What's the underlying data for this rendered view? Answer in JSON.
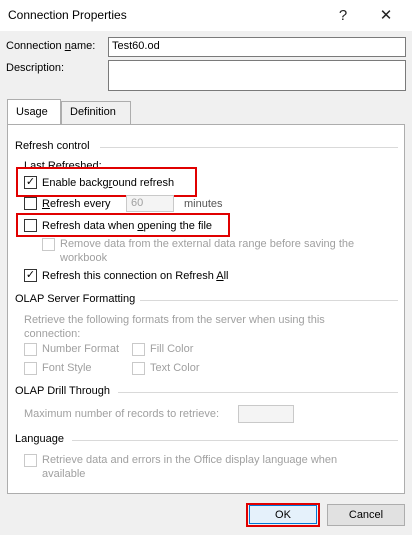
{
  "window": {
    "title": "Connection Properties",
    "help_glyph": "?",
    "close_glyph": "✕"
  },
  "connection": {
    "name_label": "Connection name:",
    "name_value": "Test60.od",
    "description_label": "Description:",
    "description_value": ""
  },
  "tabs": [
    {
      "label": "Usage",
      "active": true
    },
    {
      "label": "Definition",
      "active": false
    }
  ],
  "refresh_control": {
    "heading": "Refresh control",
    "last_refreshed_label": "Last Refreshed:",
    "enable_background": {
      "label": "Enable background refresh",
      "checked": true
    },
    "refresh_every": {
      "label": "Refresh every",
      "value": "60",
      "unit": "minutes",
      "checked": false
    },
    "refresh_on_open": {
      "label": "Refresh data when opening the file",
      "checked": false
    },
    "remove_data": {
      "label_line1": "Remove data from the external data range before saving the",
      "label_line2": "workbook",
      "checked": false
    },
    "refresh_all": {
      "label": "Refresh this connection on Refresh All",
      "checked": true
    }
  },
  "olap_formatting": {
    "heading": "OLAP Server Formatting",
    "desc_line1": "Retrieve the following formats from the server when using this",
    "desc_line2": "connection:",
    "options": {
      "number_format": "Number Format",
      "fill_color": "Fill Color",
      "font_style": "Font Style",
      "text_color": "Text Color"
    }
  },
  "olap_drill": {
    "heading": "OLAP Drill Through",
    "max_records_label": "Maximum number of records to retrieve:",
    "max_records_value": ""
  },
  "language": {
    "heading": "Language",
    "label_line1": "Retrieve data and errors in the Office display language when",
    "label_line2": "available"
  },
  "buttons": {
    "ok": "OK",
    "cancel": "Cancel"
  },
  "colors": {
    "highlight": "#e00000",
    "ok_border": "#0078d7"
  }
}
